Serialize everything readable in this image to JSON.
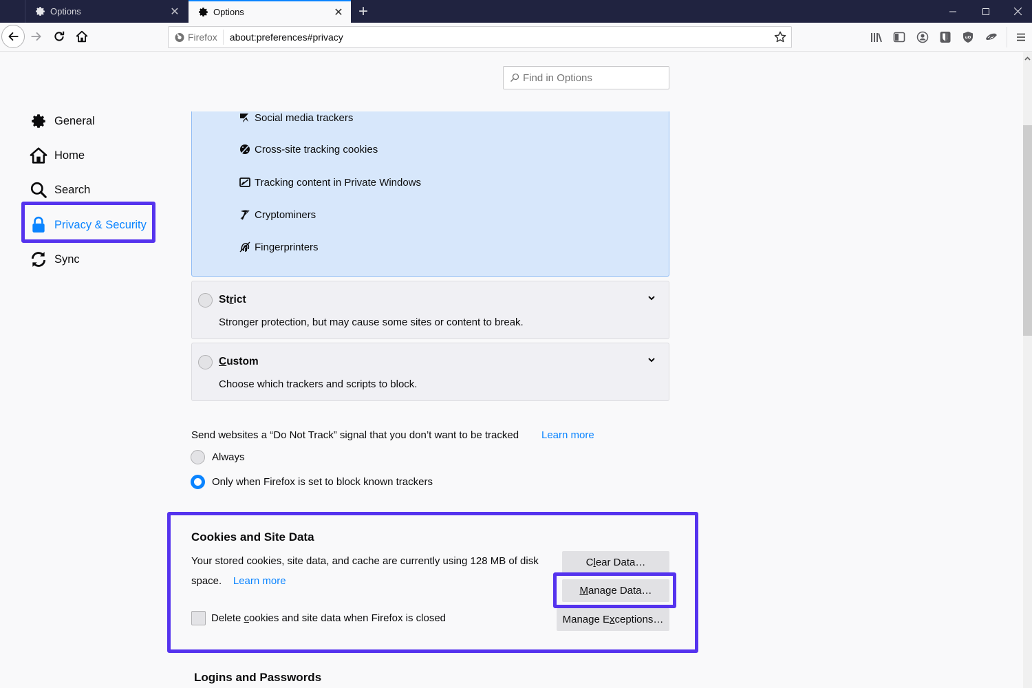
{
  "browser": {
    "tabs": [
      {
        "label": "Options",
        "icon": "gear-icon",
        "active": false
      },
      {
        "label": "Options",
        "icon": "gear-icon",
        "active": true
      }
    ],
    "new_tab_label": "+",
    "window_controls": {
      "minimize": "—",
      "maximize": "☐",
      "close": "✕"
    },
    "identity_label": "Firefox",
    "url": "about:preferences#privacy",
    "toolbar_icons": [
      "library-icon",
      "sidebar-icon",
      "account-icon",
      "bitwarden-icon",
      "ublock-origin-icon",
      "extension-icon",
      "menu-icon"
    ]
  },
  "search": {
    "placeholder": "Find in Options"
  },
  "sidebar": {
    "items": [
      {
        "label": "General",
        "icon": "gear-icon",
        "selected": false
      },
      {
        "label": "Home",
        "icon": "home-icon",
        "selected": false
      },
      {
        "label": "Search",
        "icon": "search-icon",
        "selected": false
      },
      {
        "label": "Privacy & Security",
        "icon": "lock-icon",
        "selected": true
      },
      {
        "label": "Sync",
        "icon": "sync-icon",
        "selected": false
      }
    ]
  },
  "tracking": {
    "blocked_items": [
      {
        "label": "Social media trackers",
        "icon": "social-tracker-icon"
      },
      {
        "label": "Cross-site tracking cookies",
        "icon": "cookie-blocked-icon"
      },
      {
        "label": "Tracking content in Private Windows",
        "icon": "tracking-content-icon"
      },
      {
        "label": "Cryptominers",
        "icon": "cryptominer-icon"
      },
      {
        "label": "Fingerprinters",
        "icon": "fingerprinter-icon"
      }
    ],
    "options": [
      {
        "title_pre": "St",
        "title_access": "r",
        "title_post": "ict",
        "description": "Stronger protection, but may cause some sites or content to break.",
        "selected": false
      },
      {
        "title_pre": "",
        "title_access": "C",
        "title_post": "ustom",
        "description": "Choose which trackers and scripts to block.",
        "selected": false
      }
    ]
  },
  "do_not_track": {
    "label": "Send websites a “Do Not Track” signal that you don’t want to be tracked",
    "learn_more": "Learn more",
    "options": [
      {
        "label": "Always",
        "selected": false
      },
      {
        "label": "Only when Firefox is set to block known trackers",
        "selected": true
      }
    ]
  },
  "cookies": {
    "title": "Cookies and Site Data",
    "description": "Your stored cookies, site data, and cache are currently using 128 MB of disk space.",
    "usage_value": "128 MB",
    "learn_more": "Learn more",
    "clear_button": {
      "pre": "C",
      "access": "l",
      "post": "ear Data…"
    },
    "manage_button": {
      "pre": "",
      "access": "M",
      "post": "anage Data…"
    },
    "exceptions_button": {
      "pre": "Manage E",
      "access": "x",
      "post": "ceptions…"
    },
    "delete_checkbox": {
      "pre": "Delete ",
      "access": "c",
      "post": "ookies and site data when Firefox is closed",
      "checked": false
    }
  },
  "logins": {
    "title": "Logins and Passwords"
  },
  "annotations": {
    "highlight_color": "#5533ee"
  }
}
